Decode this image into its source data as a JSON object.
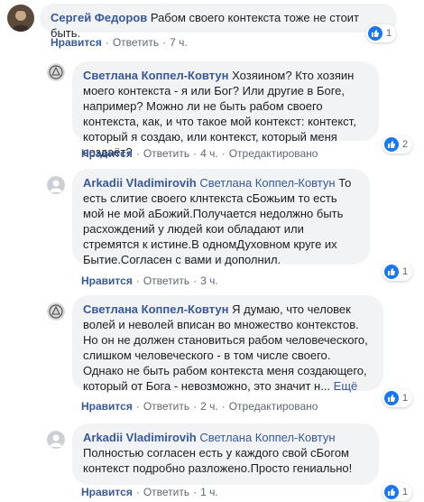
{
  "comments": [
    {
      "author": "Сергей Федоров",
      "mention": "",
      "text": "Рабом своего контекста тоже не стоит быть.",
      "actions": {
        "like": "Нравится",
        "reply": "Ответить",
        "time": "7 ч.",
        "edited": ""
      },
      "reactions": "1"
    },
    {
      "author": "Светлана Коппел-Ковтун",
      "mention": "",
      "text": "Хозяином? Кто хозяин моего контекста - я или Бог? Или другие в Боге, например? Можно ли не быть рабом своего контекста, как, и что такое мой контекст: контекст, который я создаю, или контекст, который меня создаёт?",
      "actions": {
        "like": "Нравится",
        "reply": "Ответить",
        "time": "4 ч.",
        "edited": "Отредактировано"
      },
      "reactions": "2"
    },
    {
      "author": "Arkadii Vladimirovih",
      "mention": "Светлана Коппел-Ковтун",
      "text": "То есть слитие своего клнтекста сБожьим то есть мой не мой аБожий.Получается недолжно быть расхождений у людей кои обладают или стремятся к истине.В одномДуховном круге их Бытие.Согласен с вами и дополнил.",
      "actions": {
        "like": "Нравится",
        "reply": "Ответить",
        "time": "3 ч.",
        "edited": ""
      },
      "reactions": "1"
    },
    {
      "author": "Светлана Коппел-Ковтун",
      "mention": "",
      "text": "Я думаю, что человек волей и неволей вписан во множество контекстов. Но он не должен становиться рабом человеческого, слишком человеческого - в том числе своего. Однако не быть рабом контекста меня создающего, который от Бога - невозможно, это значит н...",
      "more": "Ещё",
      "actions": {
        "like": "Нравится",
        "reply": "Ответить",
        "time": "2 ч.",
        "edited": "Отредактировано"
      },
      "reactions": "1"
    },
    {
      "author": "Arkadii Vladimirovih",
      "mention": "Светлана Коппел-Ковтун",
      "text": "Полностью согласен есть у каждого свой сБогом контекст подробно разложено.Просто гениально!",
      "actions": {
        "like": "Нравится",
        "reply": "Ответить",
        "time": "1 ч.",
        "edited": ""
      },
      "reactions": "1"
    }
  ],
  "colors": {
    "link": "#385898",
    "bubble": "#f2f3f5",
    "meta": "#606770",
    "like": "#1877f2"
  },
  "icons": {
    "like": "like-icon",
    "avatar": "avatar"
  }
}
